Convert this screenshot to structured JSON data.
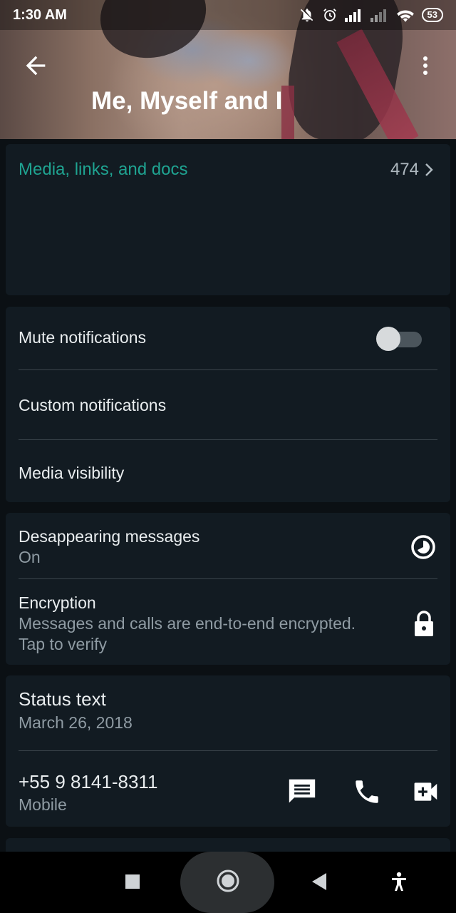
{
  "status_bar": {
    "time": "1:30 AM",
    "battery": "53"
  },
  "header": {
    "title": "Me, Myself and I",
    "back_icon": "arrow-left-icon",
    "more_icon": "more-vert-icon"
  },
  "media": {
    "label": "Media, links, and docs",
    "count": "474"
  },
  "notifications": {
    "mute_label": "Mute notifications",
    "mute_enabled": false,
    "custom_label": "Custom notifications",
    "visibility_label": "Media visibility"
  },
  "privacy": {
    "disappearing_label": "Desappearing messages",
    "disappearing_value": "On",
    "encryption_label": "Encryption",
    "encryption_line1": "Messages and calls are end-to-end encrypted.",
    "encryption_line2": "Tap to verify"
  },
  "about": {
    "status_text": "Status text",
    "status_date": "March 26, 2018",
    "phone": "+55 9 8141-8311",
    "phone_type": "Mobile"
  },
  "colors": {
    "accent": "#1fa391",
    "card": "#121b22",
    "background": "#0b1014"
  }
}
